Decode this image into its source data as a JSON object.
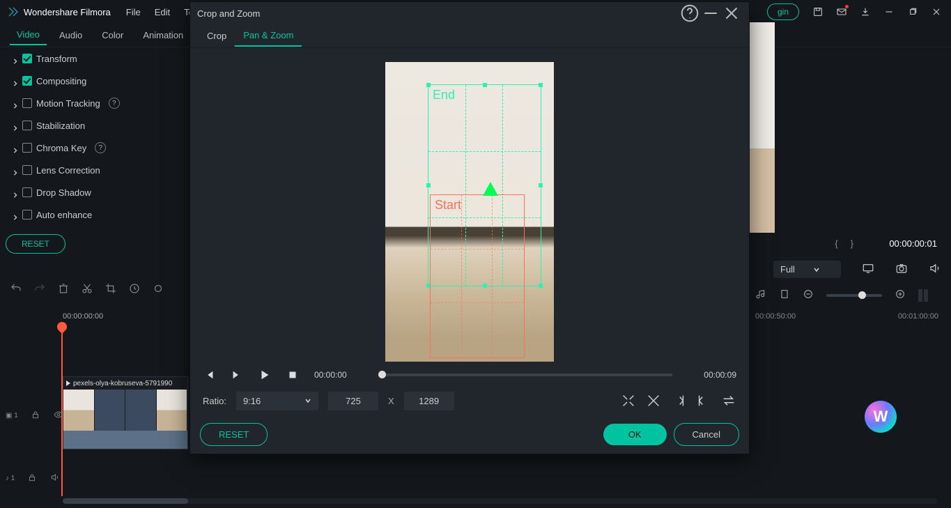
{
  "app": {
    "name": "Wondershare Filmora"
  },
  "menubar": {
    "file": "File",
    "edit": "Edit",
    "tools_partial": "To",
    "login_partial": "gin"
  },
  "left_tabs": {
    "video": "Video",
    "audio": "Audio",
    "color": "Color",
    "animation": "Animation"
  },
  "props": {
    "transform": "Transform",
    "compositing": "Compositing",
    "motion_tracking": "Motion Tracking",
    "stabilization": "Stabilization",
    "chroma_key": "Chroma Key",
    "lens_correction": "Lens Correction",
    "drop_shadow": "Drop Shadow",
    "auto_enhance": "Auto enhance"
  },
  "reset": "RESET",
  "timeline": {
    "time0": "00:00:00:00",
    "clip_name": "pexels-olya-kobruseva-5791990",
    "video_track": "1",
    "audio_track": "1"
  },
  "right": {
    "timecode": "00:00:00:01",
    "brace_l": "{",
    "brace_r": "}",
    "full": "Full",
    "ruler_50": "00:00:50:00",
    "ruler_60": "00:01:00:00"
  },
  "modal": {
    "title": "Crop and Zoom",
    "tab_crop": "Crop",
    "tab_pan": "Pan & Zoom",
    "end_label": "End",
    "start_label": "Start",
    "time_start": "00:00:00",
    "time_end": "00:00:09",
    "ratio_label": "Ratio:",
    "ratio_value": "9:16",
    "width": "725",
    "x": "X",
    "height": "1289",
    "reset": "RESET",
    "ok": "OK",
    "cancel": "Cancel"
  }
}
